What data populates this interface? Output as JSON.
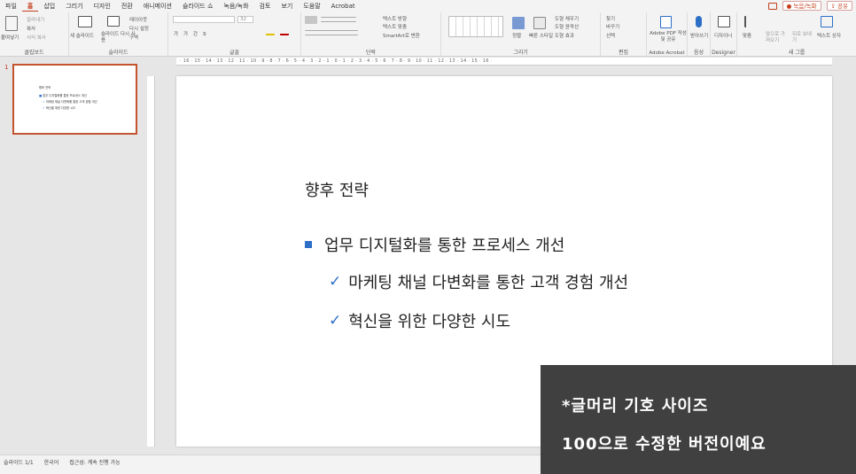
{
  "menu": {
    "tabs": [
      "파일",
      "홈",
      "삽입",
      "그리기",
      "디자인",
      "전환",
      "애니메이션",
      "슬라이드 쇼",
      "녹음/녹화",
      "검토",
      "보기",
      "도움말",
      "Acrobat"
    ],
    "active_tab": "홈",
    "record_button": "녹음/녹화",
    "share_button": "공유"
  },
  "ribbon": {
    "groups": {
      "clipboard": "클립보드",
      "slides": "슬라이드",
      "font": "글꼴",
      "paragraph": "단락",
      "drawing": "그리기",
      "editing": "편집",
      "adobe": "Adobe Acrobat",
      "voice": "음성",
      "designer": "Designer",
      "new_group": "새 그룹"
    },
    "clipboard": {
      "paste": "붙여넣기",
      "cut": "잘라내기",
      "copy": "복사",
      "format_painter": "서식 복사"
    },
    "slides": {
      "new_slide": "새 슬라이드",
      "reuse_slide": "슬라이드 다시 사용",
      "layout": "레이아웃",
      "reset": "다시 설정",
      "section": "구역"
    },
    "font": {
      "size": "32"
    },
    "paragraph": {
      "text_direction": "텍스트 방향",
      "align_text": "텍스트 맞춤",
      "smartart": "SmartArt로 변환"
    },
    "drawing": {
      "arrange": "정렬",
      "quick_styles": "빠른 스타일",
      "shape_fill": "도형 채우기",
      "shape_outline": "도형 윤곽선",
      "shape_effects": "도형 효과"
    },
    "editing": {
      "find": "찾기",
      "replace": "바꾸기",
      "select": "선택"
    },
    "adobe": {
      "create_pdf": "Adobe PDF 작성 및 공유"
    },
    "voice": {
      "dictate": "받아쓰기"
    },
    "designer": {
      "ideas": "디자이너"
    },
    "new_group": {
      "align": "맞춤",
      "bring_forward": "앞으로 가져오기",
      "send_backward": "뒤로 보내기",
      "text_box": "텍스트 상자"
    }
  },
  "ruler": {
    "horizontal": "· 16 · 15 · 14 · 13 · 12 · 11 · 10 · 9 · 8 · 7 · 6 · 5 · 4 · 3 · 2 · 1 · 0 · 1 · 2 · 3 · 4 · 5 · 6 · 7 · 8 · 9 · 10 · 11 · 12 · 13 · 14 · 15 · 16 ·"
  },
  "thumbnail": {
    "number": "1",
    "title": "향후 전략",
    "bullet": "업무 디지털화를 통한 프로세스 개선",
    "sub1": "마케팅 채널 다변화를 통한 고객 경험 개선",
    "sub2": "혁신을 위한 다양한 시도"
  },
  "slide": {
    "title": "향후 전략",
    "bullet": "업무 디지털화를 통한 프로세스 개선",
    "check_glyph": "✓",
    "sub_bullets": [
      "마케팅 채널 다변화를 통한 고객 경험 개선",
      "혁신을 위한 다양한 시도"
    ],
    "accent_color": "#2d6fc7"
  },
  "status": {
    "slide_count": "슬라이드 1/1",
    "language": "한국어",
    "accessibility": "접근성: 계속 진행 가능"
  },
  "overlay": {
    "line1": "*글머리 기호 사이즈",
    "line2": "100으로 수정한 버전이예요"
  }
}
